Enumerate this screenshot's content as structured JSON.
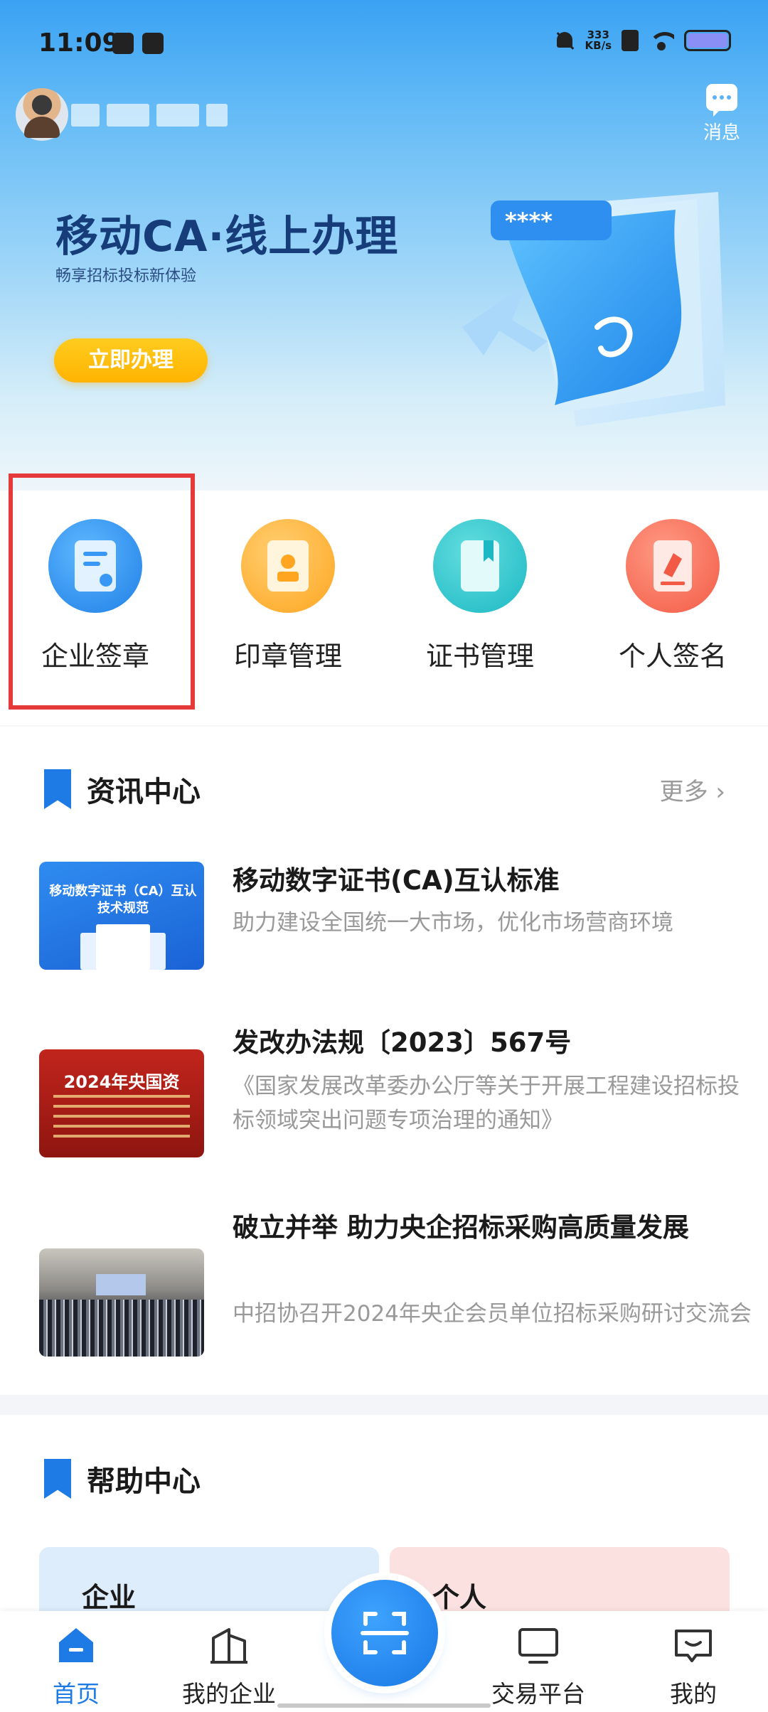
{
  "status_bar": {
    "time": "11:09",
    "net_speed_value": "333",
    "net_speed_unit": "KB/s",
    "battery_color": "#8a8ff5"
  },
  "header": {
    "message_label": "消息"
  },
  "banner": {
    "title": "移动CA·线上办理",
    "subtitle": "畅享招标投标新体验",
    "cta_label": "立即办理",
    "card_stars": "****"
  },
  "quick_actions": [
    {
      "label": "企业签章",
      "icon": "enterprise-seal-icon"
    },
    {
      "label": "印章管理",
      "icon": "seal-management-icon"
    },
    {
      "label": "证书管理",
      "icon": "certificate-icon"
    },
    {
      "label": "个人签名",
      "icon": "personal-signature-icon"
    }
  ],
  "news": {
    "title": "资讯中心",
    "more_label": "更多",
    "items": [
      {
        "title": "移动数字证书(CA)互认标准",
        "desc": "助力建设全国统一大市场，优化市场营商环境",
        "thumb_caption": "移动数字证书（CA）互认\n技术规范"
      },
      {
        "title": "发改办法规〔2023〕567号",
        "desc": "《国家发展改革委办公厅等关于开展工程建设招标投标领域突出问题专项治理的通知》",
        "thumb_caption": "2024年央国资"
      },
      {
        "title": "破立并举  助力央企招标采购高质量发展",
        "desc": "中招协召开2024年央企会员单位招标采购研讨交流会"
      }
    ]
  },
  "help": {
    "title": "帮助中心",
    "cards": [
      {
        "label": "企业"
      },
      {
        "label": "个人"
      }
    ]
  },
  "tabbar": {
    "items": [
      {
        "label": "首页",
        "active": true
      },
      {
        "label": "我的企业"
      },
      {
        "label": "交易平台"
      },
      {
        "label": "我的"
      }
    ]
  },
  "colors": {
    "accent": "#1e7be6",
    "highlight_box": "#e5393a",
    "cta": "#ffb300"
  }
}
